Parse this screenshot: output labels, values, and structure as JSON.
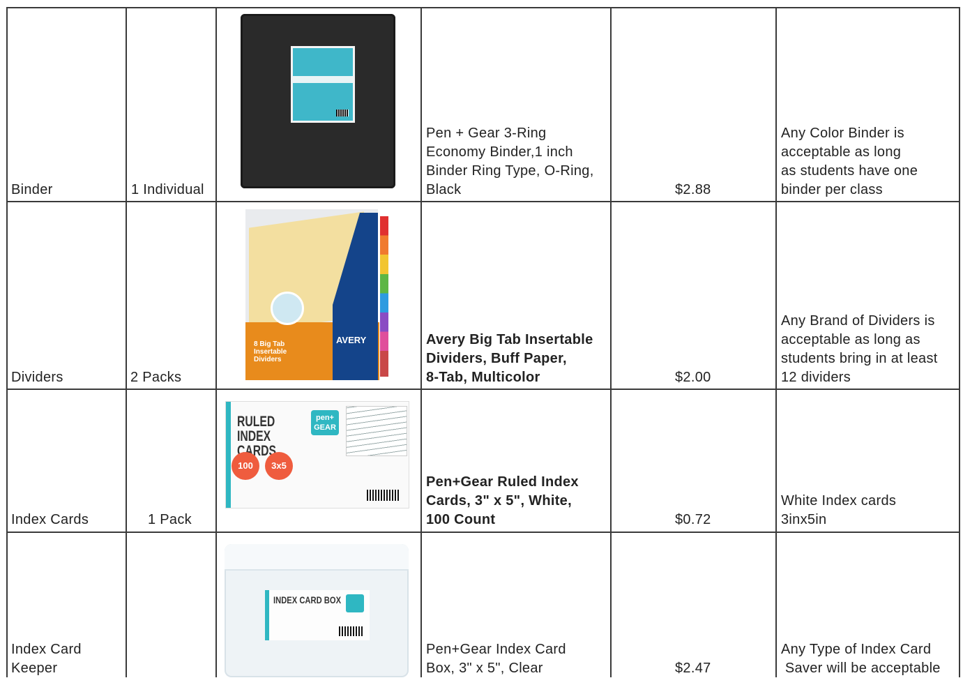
{
  "rows": [
    {
      "item": [
        "Binder"
      ],
      "quantity": "1 Individual",
      "description": [
        "Pen + Gear 3-Ring",
        "Economy Binder,1 inch",
        "Binder Ring Type, O-Ring,",
        "Black"
      ],
      "price": "$2.88",
      "notes": [
        "Any Color Binder is",
        "acceptable as long",
        "as students have one",
        "binder per class"
      ],
      "image": {
        "icon": "black-binder-image"
      }
    },
    {
      "item": [
        "Dividers"
      ],
      "quantity": "2 Packs",
      "description": [
        "Avery Big Tab Insertable",
        "Dividers, Buff Paper,",
        "8-Tab, Multicolor"
      ],
      "price": "$2.00",
      "notes": [
        "Any Brand of Dividers is",
        "acceptable as long as",
        "students bring in at least",
        "12 dividers"
      ],
      "image": {
        "icon": "avery-dividers-image",
        "logo": "AVERY",
        "label": "8 Big Tab Insertable Dividers"
      }
    },
    {
      "item": [
        "Index Cards"
      ],
      "quantity": "1 Pack",
      "description": [
        "Pen+Gear Ruled Index",
        "Cards, 3\" x 5\", White,",
        "100 Count"
      ],
      "price": "$0.72",
      "notes": [
        "White Index cards",
        "3inx5in"
      ],
      "image": {
        "icon": "index-cards-image",
        "title": "RULED INDEX CARDS",
        "count": "100",
        "size": "3x5",
        "brand": "pen+ GEAR"
      }
    },
    {
      "item": [
        "Index Card",
        "Keeper"
      ],
      "quantity": "",
      "description": [
        "Pen+Gear Index Card",
        "Box, 3\" x 5\", Clear"
      ],
      "price": "$2.47",
      "notes": [
        "Any Type of Index Card",
        " Saver will be acceptable"
      ],
      "image": {
        "icon": "index-card-box-image",
        "label": "INDEX CARD BOX"
      }
    }
  ],
  "colors": {
    "grid": "#3a3a3a",
    "text": "#222222",
    "teal": "#2fb7c2",
    "orange": "#e88b1c"
  }
}
